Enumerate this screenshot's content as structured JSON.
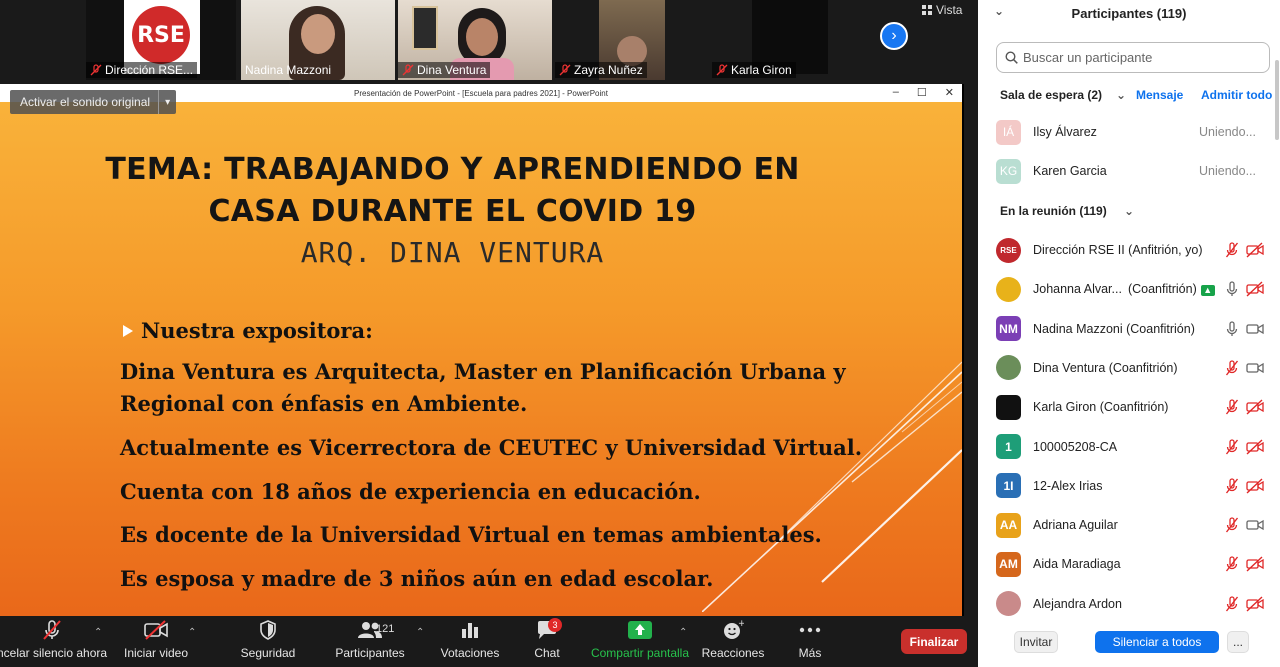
{
  "video_strip": {
    "tiles": [
      {
        "name": "Dirección RSE..."
      },
      {
        "name": "Nadina Mazzoni"
      },
      {
        "name": "Dina Ventura"
      },
      {
        "name": "Zayra Nuñez"
      },
      {
        "name": "Karla Giron"
      }
    ],
    "rse_logo_text": "RSE",
    "view_label": "Vista"
  },
  "share": {
    "window_title": "Presentación de PowerPoint - [Escuela para padres 2021] - PowerPoint",
    "unmute_label": "Activar el sonido original"
  },
  "slide": {
    "title_line1": "TEMA: TRABAJANDO Y APRENDIENDO EN",
    "title_line2": "CASA DURANTE EL COVID 19",
    "author": "ARQ. DINA VENTURA",
    "heading": "Nuestra expositora:",
    "lines": [
      "Dina Ventura es Arquitecta, Master en Planificación Urbana y",
      "Regional con énfasis en Ambiente.",
      " Actualmente es Vicerrectora de CEUTEC y Universidad Virtual.",
      "Cuenta con 18 años de experiencia en educación.",
      "Es docente de la Universidad Virtual en temas ambientales.",
      "Es esposa y madre de 3 niños aún en edad escolar."
    ]
  },
  "toolbar": {
    "unmute": "ncelar silencio ahora",
    "video": "Iniciar video",
    "security": "Seguridad",
    "participants": "Participantes",
    "participants_count": "121",
    "polls": "Votaciones",
    "chat": "Chat",
    "chat_badge": "3",
    "share": "Compartir pantalla",
    "reactions": "Reacciones",
    "more": "Más",
    "end": "Finalizar"
  },
  "panel": {
    "title": "Participantes (119)",
    "search_placeholder": "Buscar un participante",
    "waiting_room": "Sala de espera (2)",
    "message_link": "Mensaje",
    "admit_all_link": "Admitir todo",
    "waiting": [
      {
        "initials": "IÁ",
        "name": "Ilsy Álvarez",
        "status": "Uniendo..."
      },
      {
        "initials": "KG",
        "name": "Karen Garcia",
        "status": "Uniendo..."
      }
    ],
    "in_meeting": "En la reunión (119)",
    "participants": [
      {
        "initials": "RSE",
        "name": "Dirección RSE II (Anfitrión, yo)",
        "color": "#c0282d"
      },
      {
        "initials": "",
        "name": "Johanna Alvar...",
        "role": "(Coanfitrión)",
        "color": "#e8b21a"
      },
      {
        "initials": "NM",
        "name": "Nadina Mazzoni (Coanfitrión)",
        "color": "#7b3fb5"
      },
      {
        "initials": "",
        "name": "Dina Ventura (Coanfitrión)",
        "color": "#6b8e5a"
      },
      {
        "initials": "",
        "name": "Karla Giron (Coanfitrión)",
        "color": "#111111"
      },
      {
        "initials": "1",
        "name": "100005208-CA",
        "color": "#1e9e78"
      },
      {
        "initials": "1I",
        "name": "12-Alex Irias",
        "color": "#2a6fb5"
      },
      {
        "initials": "AA",
        "name": "Adriana Aguilar",
        "color": "#e8a21a"
      },
      {
        "initials": "AM",
        "name": "Aida Maradiaga",
        "color": "#d5671c"
      },
      {
        "initials": "",
        "name": "Alejandra Ardon",
        "color": "#c98a8a"
      }
    ],
    "invite": "Invitar",
    "mute_all": "Silenciar a todos",
    "more": "..."
  }
}
